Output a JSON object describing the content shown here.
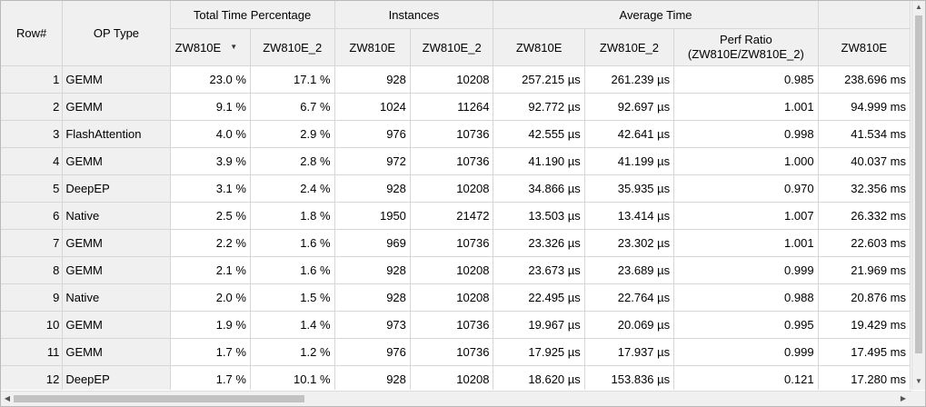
{
  "headers": {
    "row_num": "Row#",
    "op_type": "OP Type",
    "group_total_time": "Total Time Percentage",
    "group_instances": "Instances",
    "group_avg_time": "Average Time",
    "group_extra": "",
    "sub_zw810e": "ZW810E",
    "sub_zw810e_2": "ZW810E_2",
    "perf_ratio_line1": "Perf Ratio",
    "perf_ratio_line2": "(ZW810E/ZW810E_2)",
    "sort_indicator": "▼"
  },
  "rows": [
    {
      "row": "1",
      "op": "GEMM",
      "tt1": "23.0 %",
      "tt2": "17.1 %",
      "in1": "928",
      "in2": "10208",
      "av1": "257.215 µs",
      "av2": "261.239 µs",
      "ratio": "0.985",
      "extra": "238.696 ms"
    },
    {
      "row": "2",
      "op": "GEMM",
      "tt1": "9.1 %",
      "tt2": "6.7 %",
      "in1": "1024",
      "in2": "11264",
      "av1": "92.772 µs",
      "av2": "92.697 µs",
      "ratio": "1.001",
      "extra": "94.999 ms"
    },
    {
      "row": "3",
      "op": "FlashAttention",
      "tt1": "4.0 %",
      "tt2": "2.9 %",
      "in1": "976",
      "in2": "10736",
      "av1": "42.555 µs",
      "av2": "42.641 µs",
      "ratio": "0.998",
      "extra": "41.534 ms"
    },
    {
      "row": "4",
      "op": "GEMM",
      "tt1": "3.9 %",
      "tt2": "2.8 %",
      "in1": "972",
      "in2": "10736",
      "av1": "41.190 µs",
      "av2": "41.199 µs",
      "ratio": "1.000",
      "extra": "40.037 ms"
    },
    {
      "row": "5",
      "op": "DeepEP",
      "tt1": "3.1 %",
      "tt2": "2.4 %",
      "in1": "928",
      "in2": "10208",
      "av1": "34.866 µs",
      "av2": "35.935 µs",
      "ratio": "0.970",
      "extra": "32.356 ms"
    },
    {
      "row": "6",
      "op": "Native",
      "tt1": "2.5 %",
      "tt2": "1.8 %",
      "in1": "1950",
      "in2": "21472",
      "av1": "13.503 µs",
      "av2": "13.414 µs",
      "ratio": "1.007",
      "extra": "26.332 ms"
    },
    {
      "row": "7",
      "op": "GEMM",
      "tt1": "2.2 %",
      "tt2": "1.6 %",
      "in1": "969",
      "in2": "10736",
      "av1": "23.326 µs",
      "av2": "23.302 µs",
      "ratio": "1.001",
      "extra": "22.603 ms"
    },
    {
      "row": "8",
      "op": "GEMM",
      "tt1": "2.1 %",
      "tt2": "1.6 %",
      "in1": "928",
      "in2": "10208",
      "av1": "23.673 µs",
      "av2": "23.689 µs",
      "ratio": "0.999",
      "extra": "21.969 ms"
    },
    {
      "row": "9",
      "op": "Native",
      "tt1": "2.0 %",
      "tt2": "1.5 %",
      "in1": "928",
      "in2": "10208",
      "av1": "22.495 µs",
      "av2": "22.764 µs",
      "ratio": "0.988",
      "extra": "20.876 ms"
    },
    {
      "row": "10",
      "op": "GEMM",
      "tt1": "1.9 %",
      "tt2": "1.4 %",
      "in1": "973",
      "in2": "10736",
      "av1": "19.967 µs",
      "av2": "20.069 µs",
      "ratio": "0.995",
      "extra": "19.429 ms"
    },
    {
      "row": "11",
      "op": "GEMM",
      "tt1": "1.7 %",
      "tt2": "1.2 %",
      "in1": "976",
      "in2": "10736",
      "av1": "17.925 µs",
      "av2": "17.937 µs",
      "ratio": "0.999",
      "extra": "17.495 ms"
    },
    {
      "row": "12",
      "op": "DeepEP",
      "tt1": "1.7 %",
      "tt2": "10.1 %",
      "in1": "928",
      "in2": "10208",
      "av1": "18.620 µs",
      "av2": "153.836 µs",
      "ratio": "0.121",
      "extra": "17.280 ms"
    }
  ],
  "scrollbars": {
    "up_icon": "▲",
    "down_icon": "▼",
    "left_icon": "◀",
    "right_icon": "▶"
  }
}
